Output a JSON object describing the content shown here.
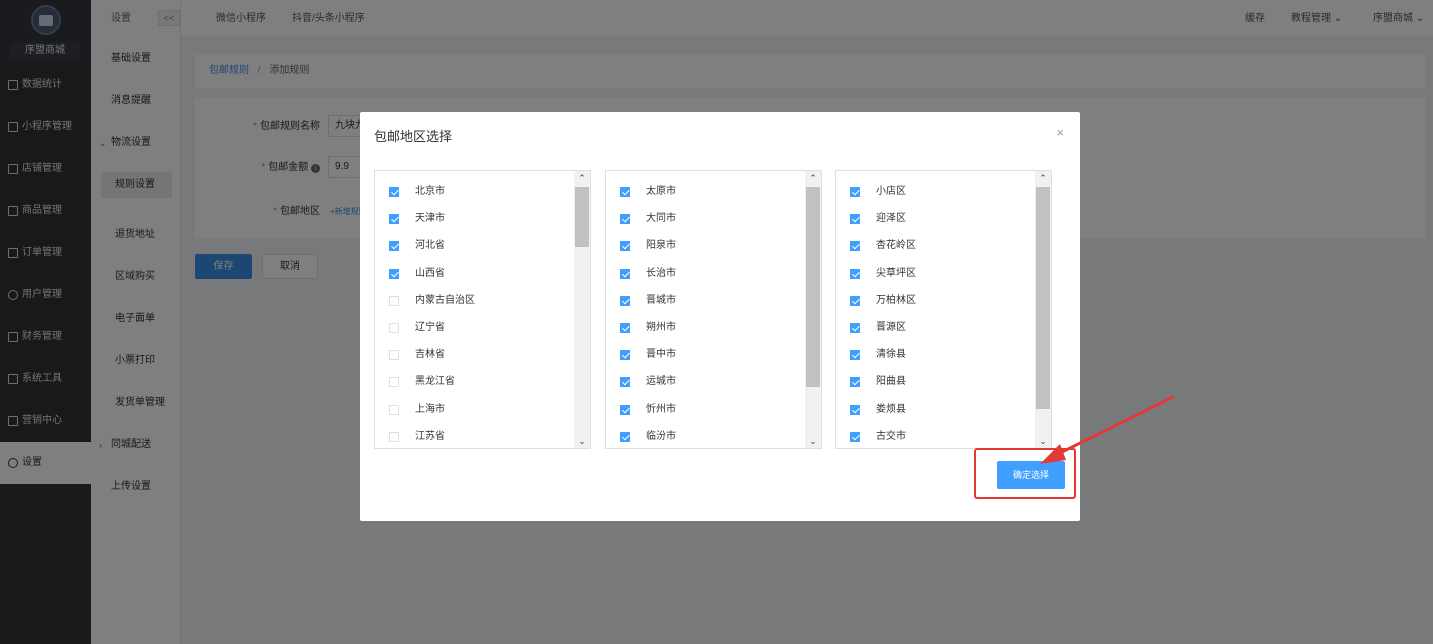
{
  "sidebar": {
    "shop_name": "序盟商城",
    "items": [
      {
        "label": "数据统计",
        "icon": "chart-icon"
      },
      {
        "label": "小程序管理",
        "icon": "link-icon"
      },
      {
        "label": "店铺管理",
        "icon": "store-icon"
      },
      {
        "label": "商品管理",
        "icon": "product-icon"
      },
      {
        "label": "订单管理",
        "icon": "order-icon"
      },
      {
        "label": "用户管理",
        "icon": "user-icon"
      },
      {
        "label": "财务管理",
        "icon": "finance-icon"
      },
      {
        "label": "系统工具",
        "icon": "wrench-icon"
      },
      {
        "label": "营销中心",
        "icon": "marketing-icon"
      },
      {
        "label": "设置",
        "icon": "gear-icon"
      }
    ]
  },
  "subbar": {
    "title": "设置",
    "collapse": "<<",
    "items": [
      {
        "label": "基础设置"
      },
      {
        "label": "消息提醒"
      },
      {
        "label": "物流设置"
      },
      {
        "label": "规则设置"
      },
      {
        "label": "退货地址"
      },
      {
        "label": "区域购买"
      },
      {
        "label": "电子面单"
      },
      {
        "label": "小票打印"
      },
      {
        "label": "发货单管理"
      },
      {
        "label": "同城配送"
      },
      {
        "label": "上传设置"
      }
    ]
  },
  "topbar": {
    "tabs": [
      "微信小程序",
      "抖音/头条小程序"
    ],
    "cache": "缓存",
    "tutorial": "教程管理",
    "shop": "序盟商城"
  },
  "breadcrumb": {
    "parent": "包邮规则",
    "sep": "/",
    "current": "添加规则"
  },
  "form": {
    "name_label": "包邮规则名称",
    "name_value": "九块九包",
    "amount_label": "包邮金额",
    "amount_value": "9.9",
    "region_label": "包邮地区",
    "add_rule": "+新增规则",
    "save": "保存",
    "cancel": "取消"
  },
  "modal": {
    "title": "包邮地区选择",
    "close": "×",
    "confirm": "确定选择",
    "provinces": [
      {
        "name": "北京市",
        "checked": true
      },
      {
        "name": "天津市",
        "checked": true
      },
      {
        "name": "河北省",
        "checked": true
      },
      {
        "name": "山西省",
        "checked": true
      },
      {
        "name": "内蒙古自治区",
        "checked": false
      },
      {
        "name": "辽宁省",
        "checked": false
      },
      {
        "name": "吉林省",
        "checked": false
      },
      {
        "name": "黑龙江省",
        "checked": false
      },
      {
        "name": "上海市",
        "checked": false
      },
      {
        "name": "江苏省",
        "checked": false
      }
    ],
    "cities": [
      {
        "name": "太原市",
        "checked": true
      },
      {
        "name": "大同市",
        "checked": true
      },
      {
        "name": "阳泉市",
        "checked": true
      },
      {
        "name": "长治市",
        "checked": true
      },
      {
        "name": "晋城市",
        "checked": true
      },
      {
        "name": "朔州市",
        "checked": true
      },
      {
        "name": "晋中市",
        "checked": true
      },
      {
        "name": "运城市",
        "checked": true
      },
      {
        "name": "忻州市",
        "checked": true
      },
      {
        "name": "临汾市",
        "checked": true
      }
    ],
    "districts": [
      {
        "name": "小店区",
        "checked": true
      },
      {
        "name": "迎泽区",
        "checked": true
      },
      {
        "name": "杏花岭区",
        "checked": true
      },
      {
        "name": "尖草坪区",
        "checked": true
      },
      {
        "name": "万柏林区",
        "checked": true
      },
      {
        "name": "晋源区",
        "checked": true
      },
      {
        "name": "清徐县",
        "checked": true
      },
      {
        "name": "阳曲县",
        "checked": true
      },
      {
        "name": "娄烦县",
        "checked": true
      },
      {
        "name": "古交市",
        "checked": true
      }
    ]
  },
  "colors": {
    "primary": "#409eff",
    "sidebar_bg": "#2f3237",
    "annotation": "#e53935"
  }
}
